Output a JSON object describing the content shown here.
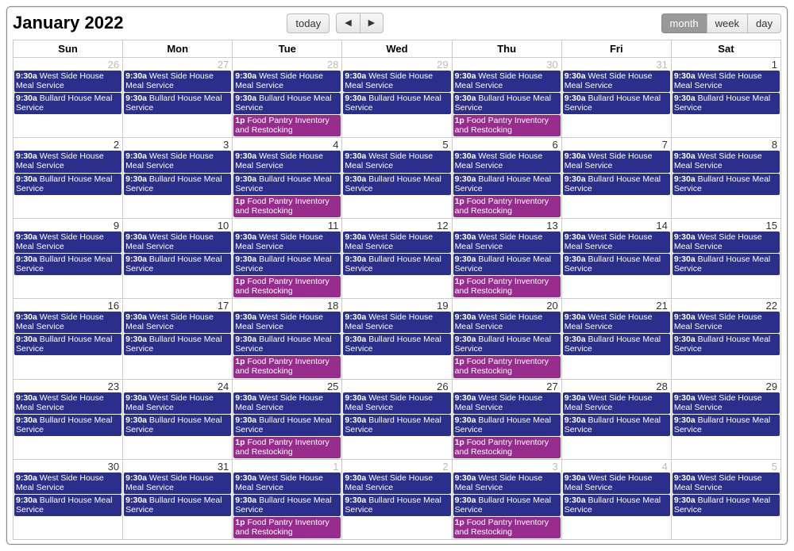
{
  "title": "January 2022",
  "buttons": {
    "today": "today",
    "prev": "◀",
    "next": "▶",
    "month": "month",
    "week": "week",
    "day": "day"
  },
  "activeView": "month",
  "dayHeaders": [
    "Sun",
    "Mon",
    "Tue",
    "Wed",
    "Thu",
    "Fri",
    "Sat"
  ],
  "recurringEvents": {
    "westSide": {
      "time": "9:30a",
      "title": "West Side House Meal Service",
      "color": "blue"
    },
    "bullard": {
      "time": "9:30a",
      "title": "Bullard House Meal Service",
      "color": "blue"
    },
    "pantry": {
      "time": "1p",
      "title": "Food Pantry Inventory and Restocking",
      "color": "purple"
    }
  },
  "weeks": [
    [
      {
        "num": 26,
        "other": true,
        "ev": [
          "westSide",
          "bullard"
        ]
      },
      {
        "num": 27,
        "other": true,
        "ev": [
          "westSide",
          "bullard"
        ]
      },
      {
        "num": 28,
        "other": true,
        "ev": [
          "westSide",
          "bullard",
          "pantry"
        ]
      },
      {
        "num": 29,
        "other": true,
        "ev": [
          "westSide",
          "bullard"
        ]
      },
      {
        "num": 30,
        "other": true,
        "ev": [
          "westSide",
          "bullard",
          "pantry"
        ]
      },
      {
        "num": 31,
        "other": true,
        "ev": [
          "westSide",
          "bullard"
        ]
      },
      {
        "num": 1,
        "other": false,
        "ev": [
          "westSide",
          "bullard"
        ]
      }
    ],
    [
      {
        "num": 2,
        "other": false,
        "ev": [
          "westSide",
          "bullard"
        ]
      },
      {
        "num": 3,
        "other": false,
        "ev": [
          "westSide",
          "bullard"
        ]
      },
      {
        "num": 4,
        "other": false,
        "ev": [
          "westSide",
          "bullard",
          "pantry"
        ]
      },
      {
        "num": 5,
        "other": false,
        "ev": [
          "westSide",
          "bullard"
        ]
      },
      {
        "num": 6,
        "other": false,
        "ev": [
          "westSide",
          "bullard",
          "pantry"
        ]
      },
      {
        "num": 7,
        "other": false,
        "ev": [
          "westSide",
          "bullard"
        ]
      },
      {
        "num": 8,
        "other": false,
        "ev": [
          "westSide",
          "bullard"
        ]
      }
    ],
    [
      {
        "num": 9,
        "other": false,
        "ev": [
          "westSide",
          "bullard"
        ]
      },
      {
        "num": 10,
        "other": false,
        "ev": [
          "westSide",
          "bullard"
        ]
      },
      {
        "num": 11,
        "other": false,
        "ev": [
          "westSide",
          "bullard",
          "pantry"
        ]
      },
      {
        "num": 12,
        "other": false,
        "ev": [
          "westSide",
          "bullard"
        ]
      },
      {
        "num": 13,
        "other": false,
        "ev": [
          "westSide",
          "bullard",
          "pantry"
        ]
      },
      {
        "num": 14,
        "other": false,
        "ev": [
          "westSide",
          "bullard"
        ]
      },
      {
        "num": 15,
        "other": false,
        "ev": [
          "westSide",
          "bullard"
        ]
      }
    ],
    [
      {
        "num": 16,
        "other": false,
        "ev": [
          "westSide",
          "bullard"
        ]
      },
      {
        "num": 17,
        "other": false,
        "ev": [
          "westSide",
          "bullard"
        ]
      },
      {
        "num": 18,
        "other": false,
        "ev": [
          "westSide",
          "bullard",
          "pantry"
        ]
      },
      {
        "num": 19,
        "other": false,
        "ev": [
          "westSide",
          "bullard"
        ]
      },
      {
        "num": 20,
        "other": false,
        "ev": [
          "westSide",
          "bullard",
          "pantry"
        ]
      },
      {
        "num": 21,
        "other": false,
        "ev": [
          "westSide",
          "bullard"
        ]
      },
      {
        "num": 22,
        "other": false,
        "ev": [
          "westSide",
          "bullard"
        ]
      }
    ],
    [
      {
        "num": 23,
        "other": false,
        "ev": [
          "westSide",
          "bullard"
        ]
      },
      {
        "num": 24,
        "other": false,
        "ev": [
          "westSide",
          "bullard"
        ]
      },
      {
        "num": 25,
        "other": false,
        "ev": [
          "westSide",
          "bullard",
          "pantry"
        ]
      },
      {
        "num": 26,
        "other": false,
        "ev": [
          "westSide",
          "bullard"
        ]
      },
      {
        "num": 27,
        "other": false,
        "ev": [
          "westSide",
          "bullard",
          "pantry"
        ]
      },
      {
        "num": 28,
        "other": false,
        "ev": [
          "westSide",
          "bullard"
        ]
      },
      {
        "num": 29,
        "other": false,
        "ev": [
          "westSide",
          "bullard"
        ]
      }
    ],
    [
      {
        "num": 30,
        "other": false,
        "ev": [
          "westSide",
          "bullard"
        ]
      },
      {
        "num": 31,
        "other": false,
        "ev": [
          "westSide",
          "bullard"
        ]
      },
      {
        "num": 1,
        "other": true,
        "ev": [
          "westSide",
          "bullard",
          "pantry"
        ]
      },
      {
        "num": 2,
        "other": true,
        "ev": [
          "westSide",
          "bullard"
        ]
      },
      {
        "num": 3,
        "other": true,
        "ev": [
          "westSide",
          "bullard",
          "pantry"
        ]
      },
      {
        "num": 4,
        "other": true,
        "ev": [
          "westSide",
          "bullard"
        ]
      },
      {
        "num": 5,
        "other": true,
        "ev": [
          "westSide",
          "bullard"
        ]
      }
    ]
  ]
}
